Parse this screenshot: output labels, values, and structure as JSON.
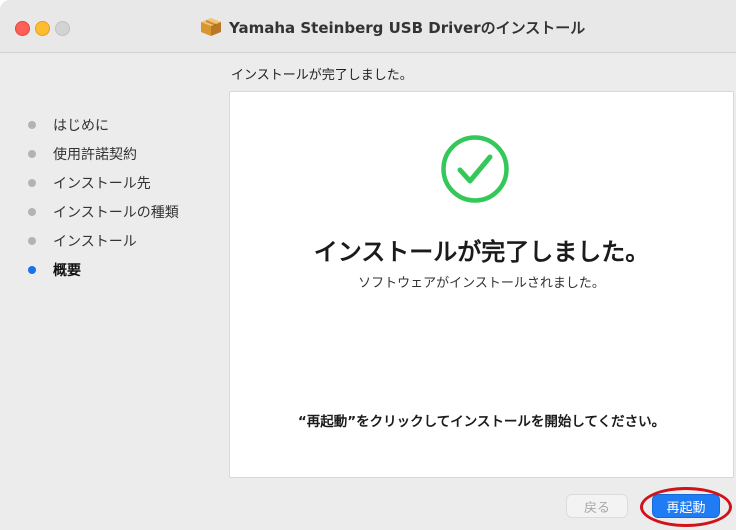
{
  "window": {
    "title": "Yamaha Steinberg USB Driverのインストール",
    "icon": "package-icon"
  },
  "main": {
    "heading": "インストールが完了しました。"
  },
  "sidebar": {
    "steps": [
      {
        "label": "はじめに",
        "active": false
      },
      {
        "label": "使用許諾契約",
        "active": false
      },
      {
        "label": "インストール先",
        "active": false
      },
      {
        "label": "インストールの種類",
        "active": false
      },
      {
        "label": "インストール",
        "active": false
      },
      {
        "label": "概要",
        "active": true
      }
    ]
  },
  "panel": {
    "status_icon": "checkmark-circle-icon",
    "title": "インストールが完了しました。",
    "subtitle": "ソフトウェアがインストールされました。",
    "instruction": "“再起動”をクリックしてインストールを開始してください。"
  },
  "buttons": {
    "back_label": "戻る",
    "back_enabled": false,
    "restart_label": "再起動"
  },
  "colors": {
    "accent": "#1f7cf4",
    "success": "#34c759",
    "active_step": "#1a73e8",
    "annotation": "#d0121b"
  }
}
